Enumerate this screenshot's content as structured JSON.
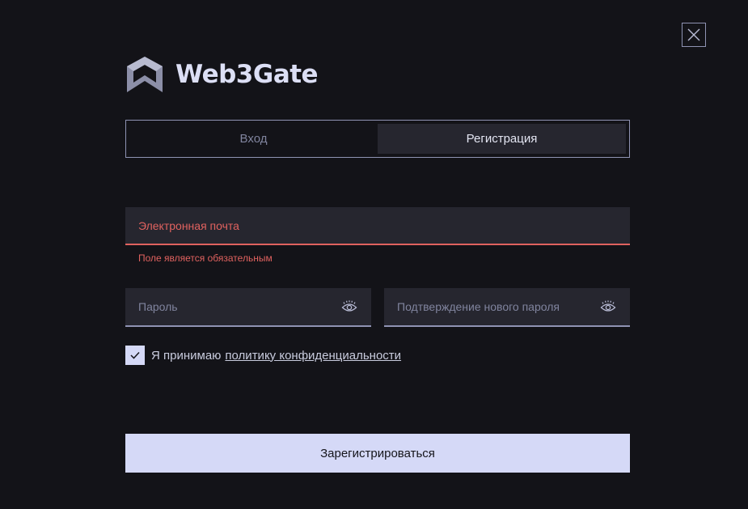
{
  "brand": {
    "name": "Web3Gate",
    "logo_icon": "web3gate-logo-icon"
  },
  "close_icon": "close-icon",
  "tabs": [
    {
      "label": "Вход",
      "active": false
    },
    {
      "label": "Регистрация",
      "active": true
    }
  ],
  "form": {
    "email": {
      "value": "",
      "placeholder": "Электронная почта",
      "error": "Поле является обязательным"
    },
    "password": {
      "value": "",
      "placeholder": "Пароль",
      "icon": "eye-icon"
    },
    "confirm_password": {
      "value": "",
      "placeholder": "Подтверждение нового пароля",
      "icon": "eye-icon"
    },
    "consent": {
      "checked": true,
      "text": "Я принимаю",
      "link_text": "политику конфиденциальности"
    },
    "submit_label": "Зарегистрироваться"
  },
  "colors": {
    "background": "#131318",
    "surface": "#26262f",
    "accent": "#d5d9f7",
    "border": "#8f93b3",
    "error": "#e0625f"
  }
}
